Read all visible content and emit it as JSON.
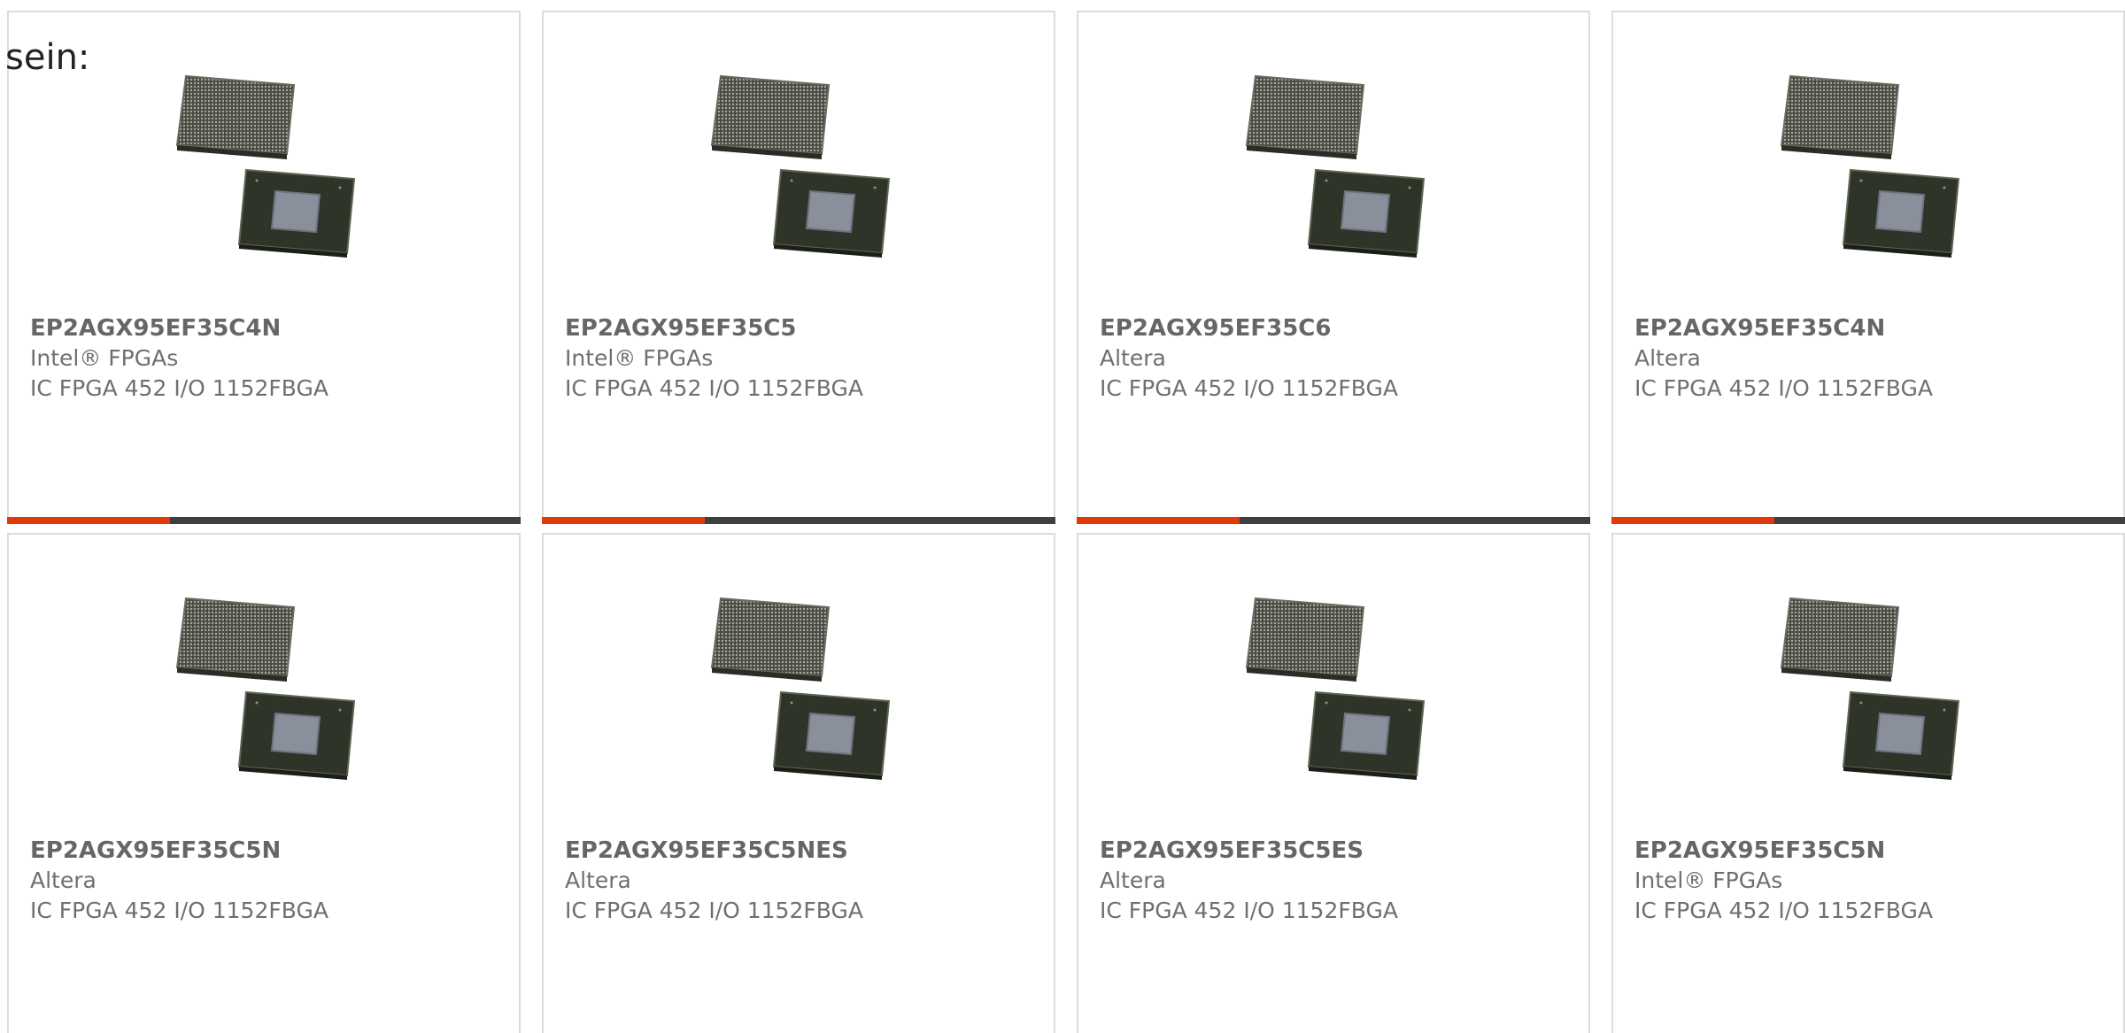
{
  "intro_text": "sein:",
  "colors": {
    "accent": "#e03a0a",
    "bar_dark": "#3d3f41",
    "card_border": "#dcdcdc",
    "text_gray": "#6f6f6f"
  },
  "image_icon": "fpga-chip-package-icon",
  "products": [
    {
      "part": "EP2AGX95EF35C4N",
      "manufacturer": "Intel® FPGAs",
      "description": "IC FPGA 452 I/O 1152FBGA"
    },
    {
      "part": "EP2AGX95EF35C5",
      "manufacturer": "Intel® FPGAs",
      "description": "IC FPGA 452 I/O 1152FBGA"
    },
    {
      "part": "EP2AGX95EF35C6",
      "manufacturer": "Altera",
      "description": "IC FPGA 452 I/O 1152FBGA"
    },
    {
      "part": "EP2AGX95EF35C4N",
      "manufacturer": "Altera",
      "description": "IC FPGA 452 I/O 1152FBGA"
    },
    {
      "part": "EP2AGX95EF35C5N",
      "manufacturer": "Altera",
      "description": "IC FPGA 452 I/O 1152FBGA"
    },
    {
      "part": "EP2AGX95EF35C5NES",
      "manufacturer": "Altera",
      "description": "IC FPGA 452 I/O 1152FBGA"
    },
    {
      "part": "EP2AGX95EF35C5ES",
      "manufacturer": "Altera",
      "description": "IC FPGA 452 I/O 1152FBGA"
    },
    {
      "part": "EP2AGX95EF35C5N",
      "manufacturer": "Intel® FPGAs",
      "description": "IC FPGA 452 I/O 1152FBGA"
    }
  ]
}
